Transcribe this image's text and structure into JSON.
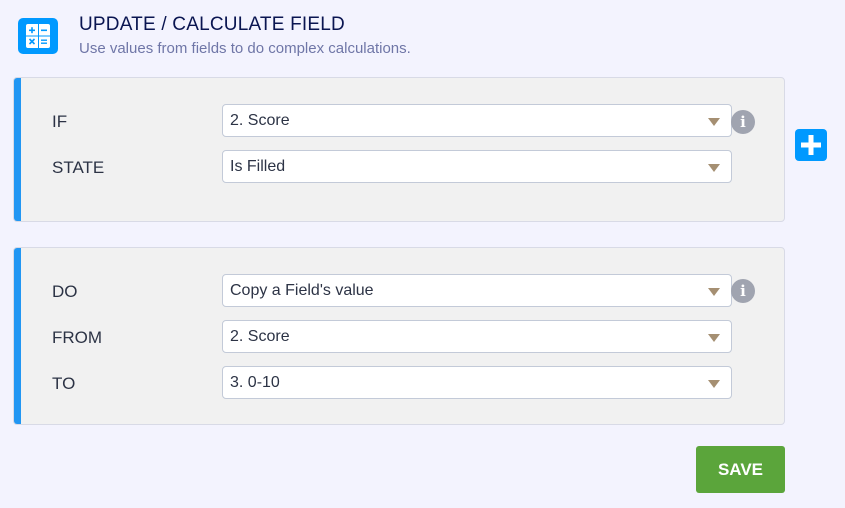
{
  "header": {
    "icon": "calculator-icon",
    "title": "UPDATE / CALCULATE FIELD",
    "subtitle": "Use values from fields to do complex calculations."
  },
  "condition": {
    "rows": [
      {
        "label": "IF",
        "value": "2. Score"
      },
      {
        "label": "STATE",
        "value": "Is Filled"
      }
    ],
    "info_icon": "info-icon"
  },
  "action": {
    "rows": [
      {
        "label": "DO",
        "value": "Copy a Field's value"
      },
      {
        "label": "FROM",
        "value": "2. Score"
      },
      {
        "label": "TO",
        "value": "3. 0-10"
      }
    ],
    "info_icon": "info-icon"
  },
  "add_condition_icon": "plus-icon",
  "save_label": "SAVE",
  "colors": {
    "accent": "#2196f3",
    "brand_blue": "#0099ff",
    "save_green": "#5ba53b",
    "title": "#0a1551",
    "subtitle": "#6f76a7"
  }
}
